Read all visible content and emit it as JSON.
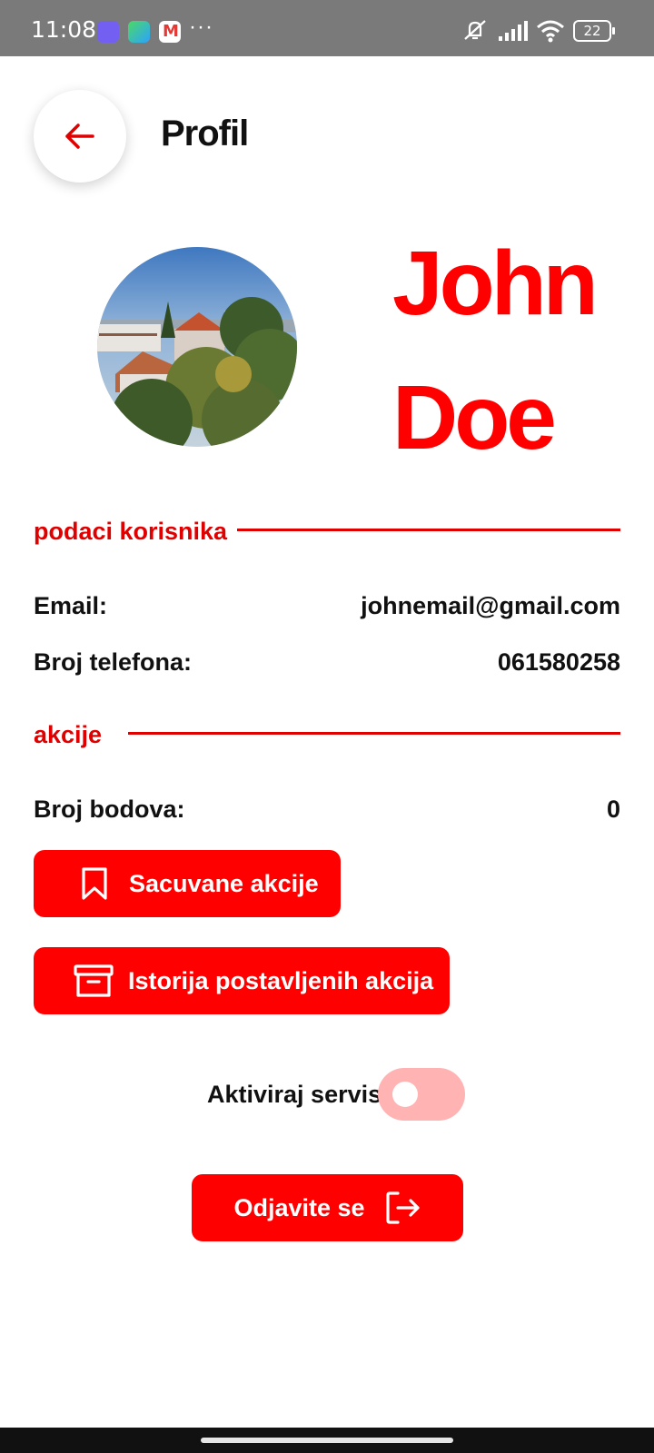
{
  "status_bar": {
    "time": "11:08",
    "more": "···",
    "battery": "22"
  },
  "header": {
    "back_icon": "arrow-left-icon",
    "title": "Profil"
  },
  "profile": {
    "first_name": "John",
    "last_name": "Doe",
    "avatar": "profile-photo"
  },
  "sections": {
    "user_data": "podaci korisnika",
    "actions": "akcije"
  },
  "user_data": {
    "email_label": "Email:",
    "email_value": "johnemail@gmail.com",
    "phone_label": "Broj telefona:",
    "phone_value": "061580258"
  },
  "actions": {
    "points_label": "Broj bodova:",
    "points_value": "0",
    "saved_label": "Sacuvane akcije",
    "saved_icon": "bookmark-icon",
    "history_label": "Istorija postavljenih akcija",
    "history_icon": "archive-icon"
  },
  "service": {
    "label": "Aktiviraj servis",
    "enabled": false
  },
  "logout": {
    "label": "Odjavite se",
    "icon": "logout-icon"
  },
  "colors": {
    "accent": "#ff0000",
    "section": "#e00000",
    "toggle_off": "#ffb3b3"
  }
}
